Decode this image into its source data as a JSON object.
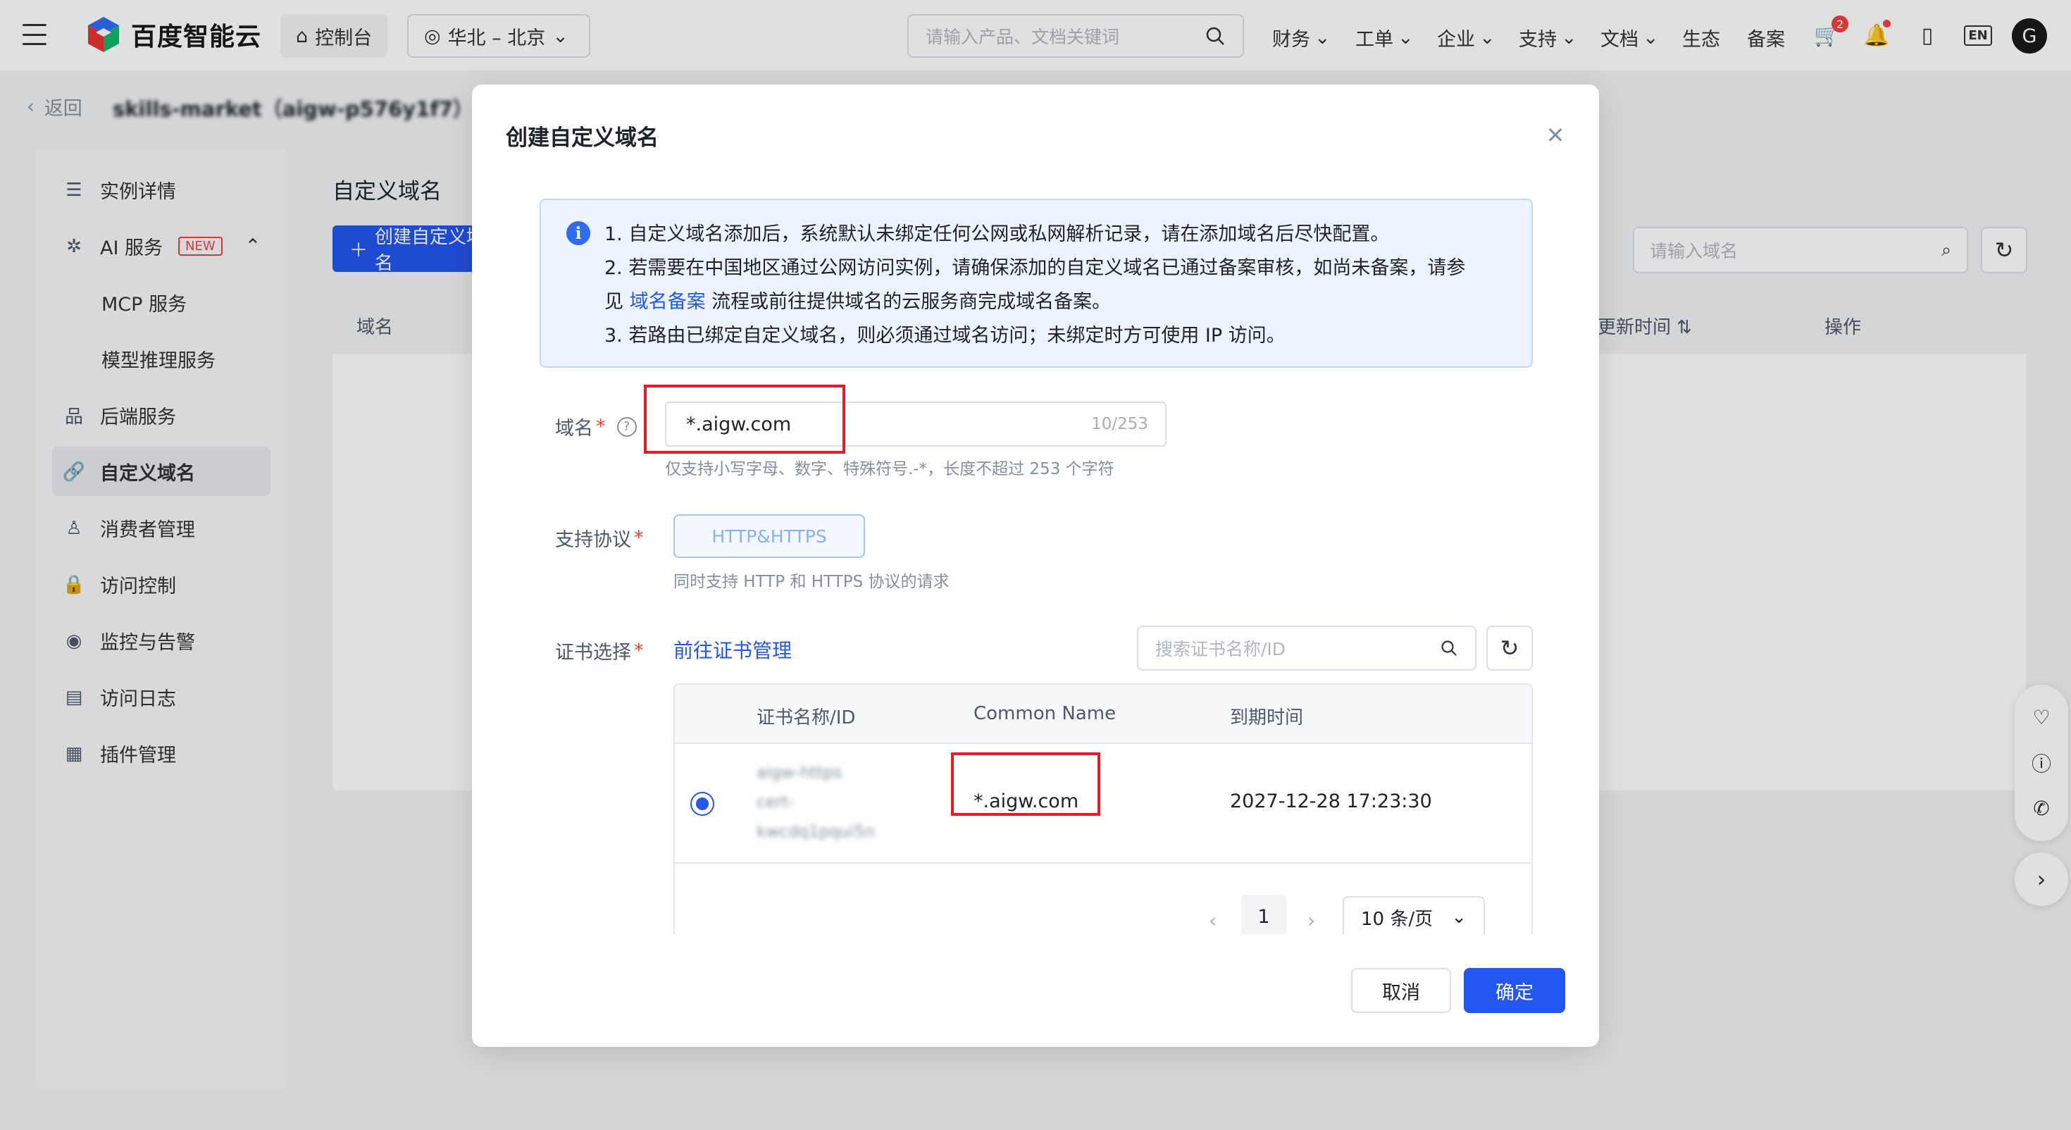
{
  "topbar": {
    "brand": "百度智能云",
    "console_label": "控制台",
    "region_label": "华北 – 北京",
    "search_placeholder": "请输入产品、文档关键词",
    "menus": [
      "财务",
      "工单",
      "企业",
      "支持",
      "文档"
    ],
    "links": [
      "生态",
      "备案"
    ],
    "cart_badge": "2",
    "lang": "EN",
    "avatar_letter": "G"
  },
  "breadcrumb": {
    "back_label": "返回",
    "title": "skills-market（aigw-p576y1f7）"
  },
  "sidebar": {
    "items": [
      {
        "label": "实例详情",
        "icon": "doc-icon"
      },
      {
        "label": "AI 服务",
        "icon": "ai-icon",
        "tag": "NEW"
      },
      {
        "label": "MCP 服务"
      },
      {
        "label": "模型推理服务"
      },
      {
        "label": "后端服务",
        "icon": "sitemap-icon"
      },
      {
        "label": "自定义域名",
        "icon": "link-icon"
      },
      {
        "label": "消费者管理",
        "icon": "user-icon"
      },
      {
        "label": "访问控制",
        "icon": "lock-icon"
      },
      {
        "label": "监控与告警",
        "icon": "monitor-icon"
      },
      {
        "label": "访问日志",
        "icon": "log-icon"
      },
      {
        "label": "插件管理",
        "icon": "grid-icon"
      }
    ]
  },
  "main": {
    "title": "自定义域名",
    "create_label": "创建自定义域名",
    "search_placeholder": "请输入域名",
    "columns": [
      "域名",
      "更新时间",
      "操作"
    ]
  },
  "modal": {
    "title": "创建自定义域名",
    "notice": {
      "line1": "1. 自定义域名添加后，系统默认未绑定任何公网或私网解析记录，请在添加域名后尽快配置。",
      "line2": "2. 若需要在中国地区通过公网访问实例，请确保添加的自定义域名已通过备案审核，如尚未备案，请参",
      "line3_pre": "见 ",
      "line3_link": "域名备案",
      "line3_post": " 流程或前往提供域名的云服务商完成域名备案。",
      "line4": "3. 若路由已绑定自定义域名，则必须通过域名访问；未绑定时方可使用 IP 访问。"
    },
    "domain": {
      "label": "域名",
      "value": "*.aigw.com",
      "count": "10/253",
      "hint": "仅支持小写字母、数字、特殊符号.-*，长度不超过 253 个字符"
    },
    "protocol": {
      "label": "支持协议",
      "option": "HTTP&HTTPS",
      "hint": "同时支持 HTTP 和 HTTPS 协议的请求"
    },
    "cert": {
      "label": "证书选择",
      "manage_link": "前往证书管理",
      "search_placeholder": "搜索证书名称/ID",
      "columns": [
        "证书名称/ID",
        "Common Name",
        "到期时间"
      ],
      "rows": [
        {
          "name": "aigw-https",
          "id_a": "cert-",
          "id_b": "kwcdq1pqui5n",
          "common_name": "*.aigw.com",
          "expires": "2027-12-28 17:23:30",
          "selected": true
        }
      ],
      "page": "1",
      "page_size": "10 条/页"
    },
    "cancel_label": "取消",
    "ok_label": "确定"
  }
}
